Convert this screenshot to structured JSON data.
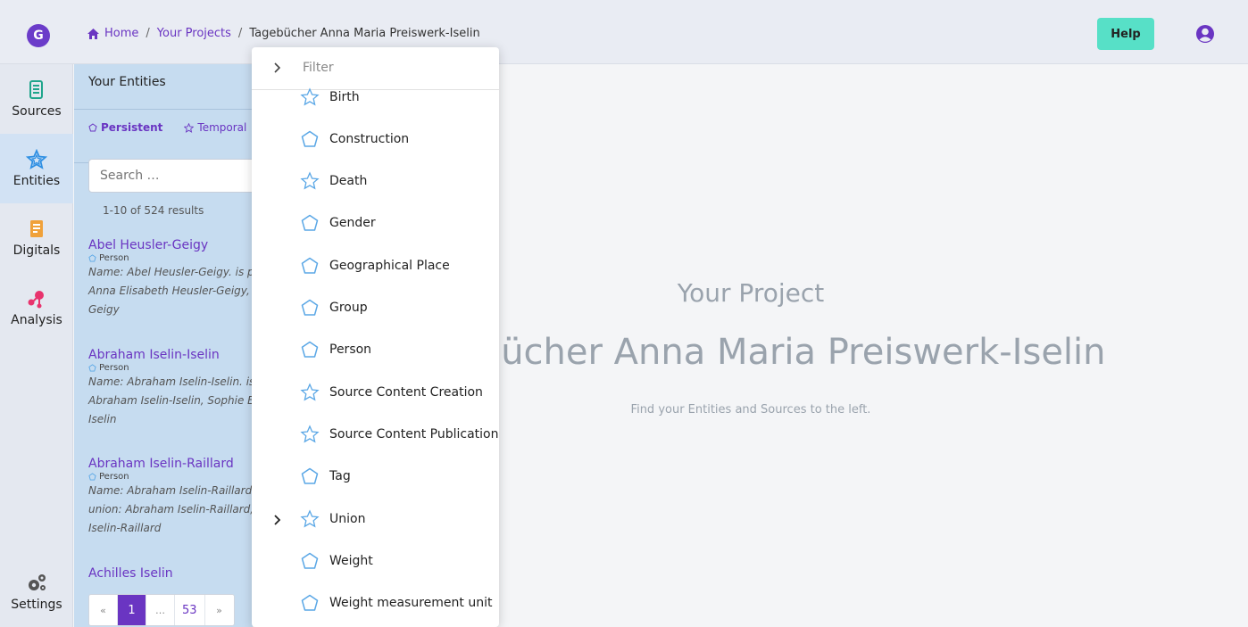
{
  "topbar": {
    "logo_letter": "G",
    "breadcrumb": {
      "home": "Home",
      "projects": "Your Projects",
      "current": "Tagebücher Anna Maria Preiswerk-Iselin"
    },
    "help_label": "Help"
  },
  "rail": {
    "items": [
      {
        "label": "Sources",
        "icon": "scroll-icon"
      },
      {
        "label": "Entities",
        "icon": "star-icon"
      },
      {
        "label": "Digitals",
        "icon": "document-icon"
      },
      {
        "label": "Analysis",
        "icon": "graph-icon"
      },
      {
        "label": "Settings",
        "icon": "gears-icon"
      }
    ],
    "active": "Entities"
  },
  "panel": {
    "header": "Your Entities",
    "tabs": [
      {
        "label": "Persistent",
        "active": true
      },
      {
        "label": "Temporal",
        "active": false
      }
    ],
    "search_placeholder": "Search …",
    "results_count": "1-10 of 524 results",
    "entities": [
      {
        "title": "Abel Heusler-Geigy",
        "type": "Person",
        "desc": "Name: Abel Heusler-Geigy. is pa Anna Elisabeth Heusler-Geigy, A Geigy"
      },
      {
        "title": "Abraham Iselin-Iselin",
        "type": "Person",
        "desc": "Name: Abraham Iselin-Iselin. is p Abraham Iselin-Iselin, Sophie El Iselin"
      },
      {
        "title": "Abraham Iselin-Raillard",
        "type": "Person",
        "desc": "Name: Abraham Iselin-Raillard. union: Abraham Iselin-Raillard, Iselin-Raillard"
      },
      {
        "title": "Achilles Iselin",
        "type": "",
        "desc": ""
      }
    ],
    "pagination": {
      "prev": "«",
      "current": "1",
      "ellipsis": "…",
      "last": "53",
      "next": "»"
    }
  },
  "main": {
    "subtitle": "Your Project",
    "title": "Tagebücher Anna Maria Preiswerk-Iselin",
    "hint": "Find your Entities and Sources to the left."
  },
  "dropdown": {
    "filter_placeholder": "Filter",
    "items": [
      {
        "label": "Birth",
        "icon": "star-outline-icon",
        "expandable": false
      },
      {
        "label": "Construction",
        "icon": "pentagon-outline-icon",
        "expandable": false
      },
      {
        "label": "Death",
        "icon": "star-outline-icon",
        "expandable": false
      },
      {
        "label": "Gender",
        "icon": "pentagon-outline-icon",
        "expandable": false
      },
      {
        "label": "Geographical Place",
        "icon": "pentagon-outline-icon",
        "expandable": false
      },
      {
        "label": "Group",
        "icon": "pentagon-outline-icon",
        "expandable": false
      },
      {
        "label": "Person",
        "icon": "pentagon-outline-icon",
        "expandable": false
      },
      {
        "label": "Source Content Creation",
        "icon": "star-outline-icon",
        "expandable": false
      },
      {
        "label": "Source Content Publication E",
        "icon": "star-outline-icon",
        "expandable": false
      },
      {
        "label": "Tag",
        "icon": "pentagon-outline-icon",
        "expandable": false
      },
      {
        "label": "Union",
        "icon": "star-outline-icon",
        "expandable": true
      },
      {
        "label": "Weight",
        "icon": "pentagon-outline-icon",
        "expandable": false
      },
      {
        "label": "Weight measurement unit",
        "icon": "pentagon-outline-icon",
        "expandable": false
      }
    ]
  },
  "colors": {
    "accent": "#6a35c2",
    "help": "#57e0c7",
    "panel": "#c6dcf0",
    "icon_blue": "#5aa7e6"
  }
}
